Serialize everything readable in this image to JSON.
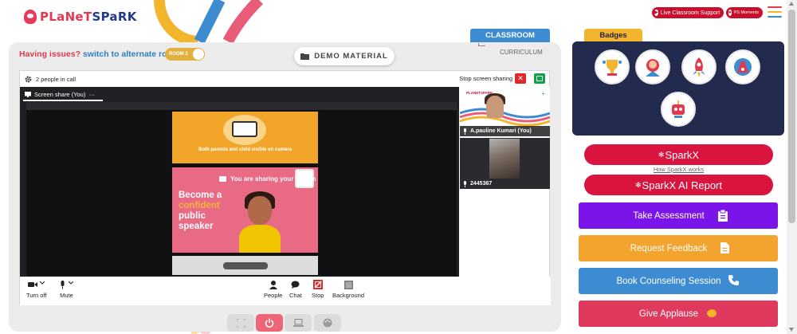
{
  "brand": {
    "part1": "PLaNeT",
    "part2": "SPaRK"
  },
  "header": {
    "live_support_label": "Live Classroom Support",
    "ps_moments_label": "PS Moments",
    "menu_icon": "hamburger-menu-icon"
  },
  "classroom": {
    "issue_text": "Having issues?",
    "alternate_link": "switch to alternate room",
    "room_toggle_label": "ROOM 2",
    "demo_material_label": "DEMO MATERIAL",
    "classroom_tab": "CLASSROOM",
    "curriculum_tab": "CURRICULUM"
  },
  "call": {
    "people_count": "2 people in call",
    "stop_share_label": "Stop screen sharing",
    "share_tab_label": "Screen share (You)",
    "share_tab_menu": "···",
    "sharing_message": "You are sharing your screen",
    "slide_top_text": "Both parents and child visible on camera",
    "slide_headline": {
      "line1": "Become a",
      "line2": "confident",
      "line3": "public",
      "line4": "speaker"
    },
    "participants": [
      {
        "name": "A.pauline Kumari (You)"
      },
      {
        "name": "2445367"
      }
    ],
    "controls": {
      "turn_off": "Turn off",
      "mute": "Mute",
      "people": "People",
      "chat": "Chat",
      "stop": "Stop",
      "background": "Background"
    }
  },
  "badges": {
    "title": "Badges",
    "items": [
      "trophy-badge-icon",
      "speaker-badge-icon",
      "rocket-badge-icon",
      "lab-badge-icon",
      "robot-badge-icon"
    ]
  },
  "actions": {
    "sparkx": "SparkX",
    "how_sparkx": "How SparkX works",
    "sparkx_report": "SparkX AI Report",
    "take_assessment": "Take Assessment",
    "request_feedback": "Request Feedback",
    "book_counseling": "Book Counseling Session",
    "give_applause": "Give Applause"
  },
  "colors": {
    "brand_red": "#d8143f",
    "purple": "#7a14e8",
    "orange": "#f3a42e",
    "blue": "#3d8bd0",
    "pink": "#df3a5d",
    "navy": "#222a4e",
    "badge_yellow": "#f3b42e"
  }
}
